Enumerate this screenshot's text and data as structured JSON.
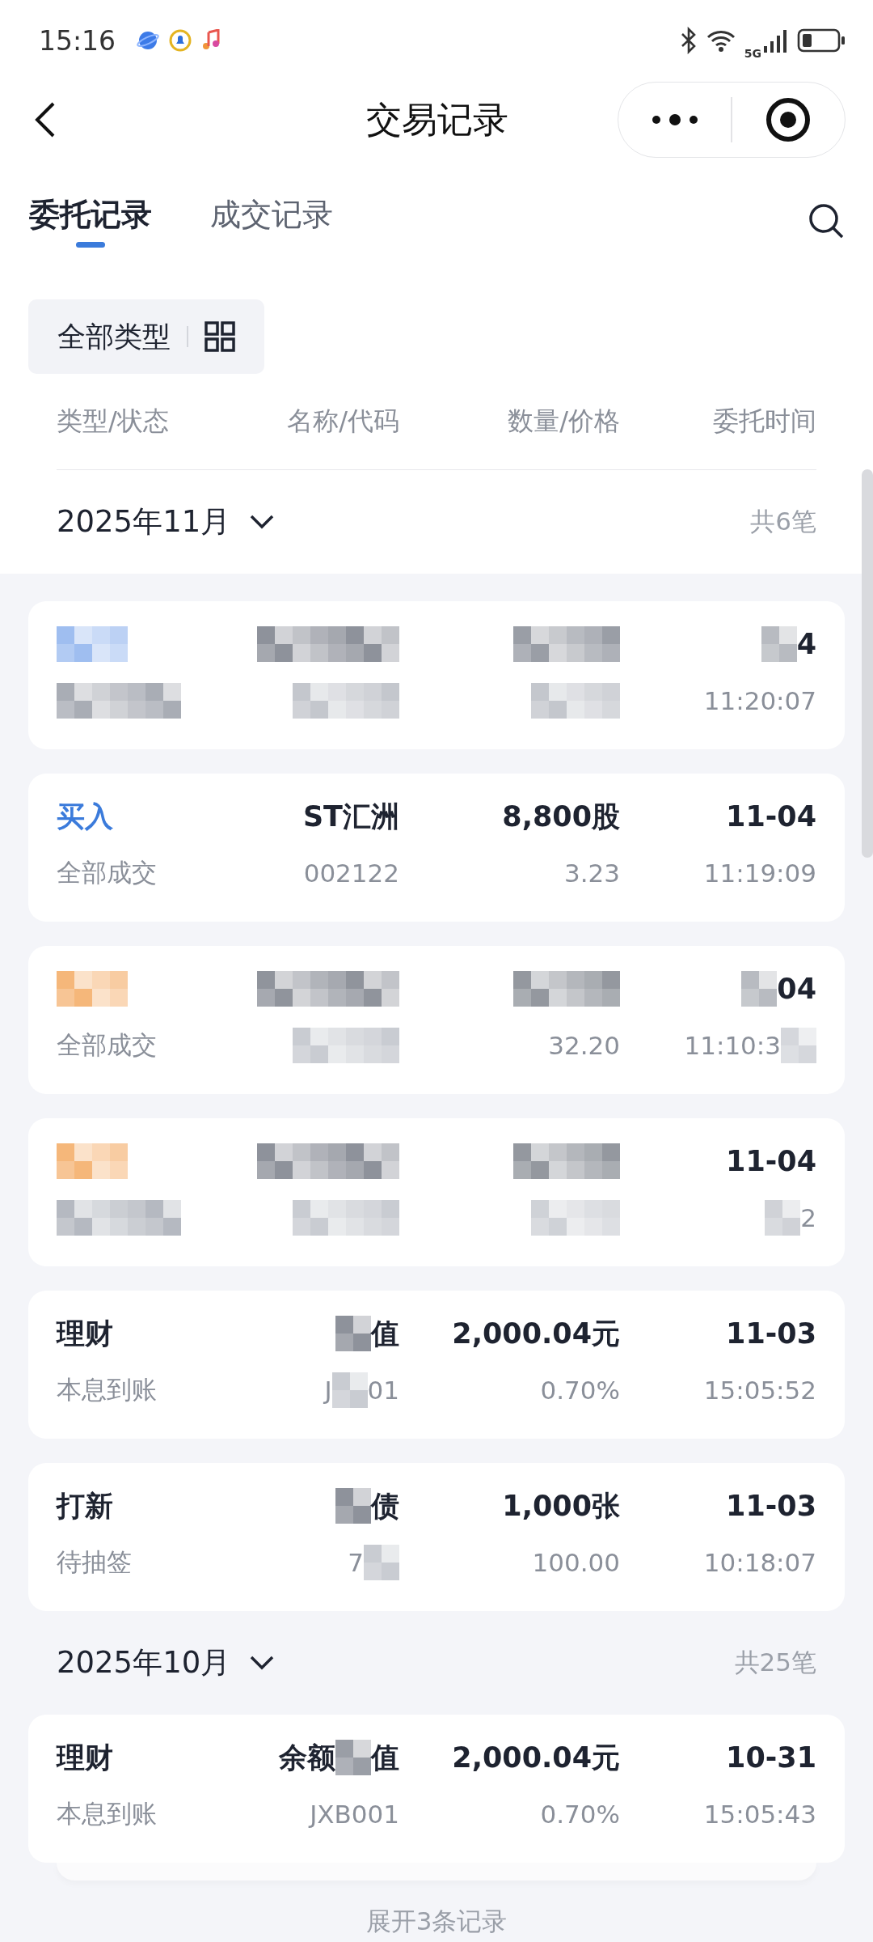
{
  "status_bar": {
    "time": "15:16",
    "network": "5G"
  },
  "nav": {
    "title": "交易记录"
  },
  "tabs": [
    {
      "label": "委托记录",
      "selected": true
    },
    {
      "label": "成交记录",
      "selected": false
    }
  ],
  "filter": {
    "label": "全部类型"
  },
  "columns": [
    "类型/状态",
    "名称/代码",
    "数量/价格",
    "委托时间"
  ],
  "months": [
    {
      "title": "2025年11月",
      "count": "共6笔",
      "records": [
        {
          "type": [
            {
              "kind": "mosaic",
              "color": "#9fbef0"
            }
          ],
          "status": [
            {
              "kind": "mosaic",
              "color": "#a9adb5"
            }
          ],
          "name": [
            {
              "kind": "mosaic",
              "color": "#8e929b"
            }
          ],
          "code": [
            {
              "kind": "mosaic",
              "color": "#c4c7cd"
            }
          ],
          "qty": [
            {
              "kind": "mosaic",
              "color": "#9a9ea6"
            }
          ],
          "price": [
            {
              "kind": "mosaic",
              "color": "#c4c7cd"
            }
          ],
          "date": [
            {
              "kind": "mosaic",
              "color": "#b8bbc1"
            },
            "4"
          ],
          "time": [
            "11:20:07"
          ]
        },
        {
          "color": "#3b7bdb",
          "type": [
            "买入"
          ],
          "status": [
            "全部成交"
          ],
          "name": [
            "ST汇洲"
          ],
          "code": [
            "002122"
          ],
          "qty": [
            "8,800股"
          ],
          "price": [
            "3.23"
          ],
          "date": [
            "11-04"
          ],
          "time": [
            "11:19:09"
          ]
        },
        {
          "type": [
            {
              "kind": "mosaic",
              "color": "#f5b77a"
            }
          ],
          "status": [
            "全部成交"
          ],
          "name": [
            {
              "kind": "mosaic",
              "color": "#90949c"
            }
          ],
          "code": [
            {
              "kind": "mosaic",
              "color": "#c9ccd2"
            }
          ],
          "qty": [
            {
              "kind": "mosaic",
              "color": "#94989f"
            }
          ],
          "price": [
            "32.20"
          ],
          "date": [
            {
              "kind": "mosaic",
              "color": "#b8bbc1"
            },
            "04"
          ],
          "time": [
            "11:10:3",
            {
              "kind": "mosaic",
              "color": "#d5d7dc"
            }
          ]
        },
        {
          "type": [
            {
              "kind": "mosaic",
              "color": "#f5b77a"
            }
          ],
          "status": [
            {
              "kind": "mosaic",
              "color": "#b5b9c1"
            }
          ],
          "name": [
            {
              "kind": "mosaic",
              "color": "#8e929b"
            }
          ],
          "code": [
            {
              "kind": "mosaic",
              "color": "#c9ccd2"
            }
          ],
          "qty": [
            {
              "kind": "mosaic",
              "color": "#94989f"
            }
          ],
          "price": [
            {
              "kind": "mosaic",
              "color": "#cfd2d7"
            }
          ],
          "date": [
            "11-04"
          ],
          "time": [
            {
              "kind": "mosaic",
              "color": "#d0d2d7"
            },
            "2"
          ]
        },
        {
          "color": "#1e2330",
          "type": [
            "理财"
          ],
          "status": [
            "本息到账"
          ],
          "name": [
            {
              "kind": "mosaic",
              "color": "#8e929b"
            },
            "值"
          ],
          "code": [
            "J",
            {
              "kind": "mosaic",
              "color": "#c9ccd2"
            },
            "01"
          ],
          "qty": [
            "2,000.04元"
          ],
          "price": [
            "0.70%"
          ],
          "date": [
            "11-03"
          ],
          "time": [
            "15:05:52"
          ]
        },
        {
          "color": "#1e2330",
          "type": [
            "打新"
          ],
          "status": [
            "待抽签"
          ],
          "name": [
            {
              "kind": "mosaic",
              "color": "#8e929b"
            },
            "债"
          ],
          "code": [
            "7",
            {
              "kind": "mosaic",
              "color": "#c9ccd2"
            }
          ],
          "qty": [
            "1,000张"
          ],
          "price": [
            "100.00"
          ],
          "date": [
            "11-03"
          ],
          "time": [
            "10:18:07"
          ]
        }
      ]
    },
    {
      "title": "2025年10月",
      "count": "共25笔",
      "more": "展开3条记录",
      "records": [
        {
          "color": "#1e2330",
          "type": [
            "理财"
          ],
          "status": [
            "本息到账"
          ],
          "name": [
            "余额",
            {
              "kind": "mosaic",
              "color": "#9a9ea6"
            },
            "值"
          ],
          "code": [
            "JXB001"
          ],
          "qty": [
            "2,000.04元"
          ],
          "price": [
            "0.70%"
          ],
          "date": [
            "10-31"
          ],
          "time": [
            "15:05:43"
          ]
        }
      ]
    }
  ]
}
